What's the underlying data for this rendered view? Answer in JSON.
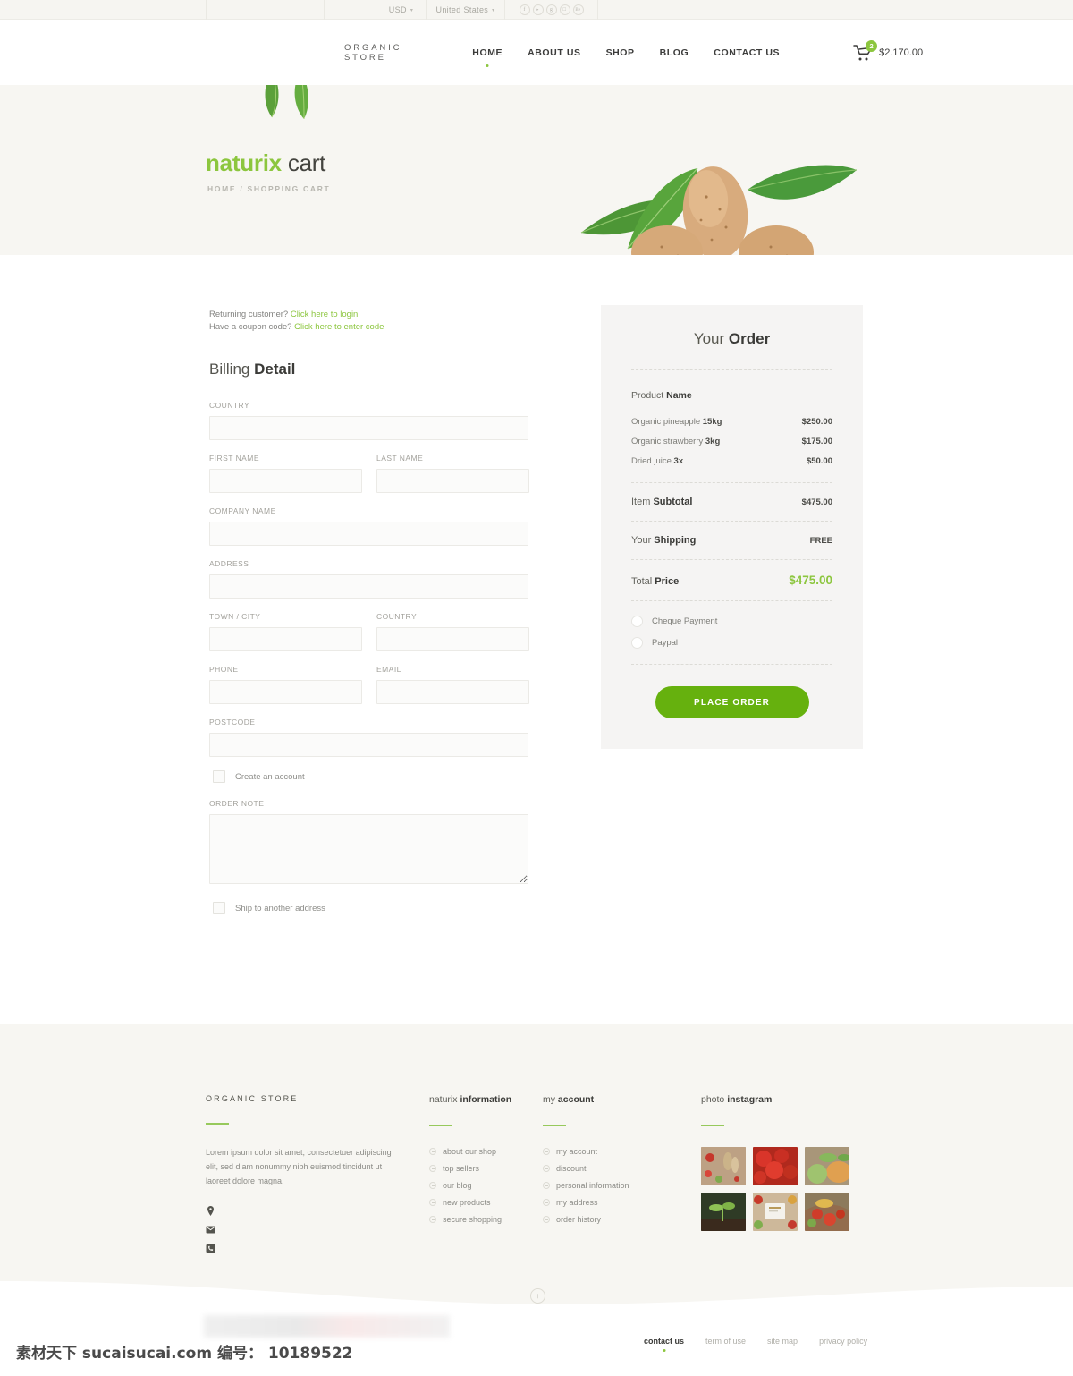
{
  "topbar": {
    "currency": {
      "label": "USD",
      "caret": "chevron-down-icon"
    },
    "country": {
      "label": "United States",
      "caret": "chevron-down-icon"
    },
    "social": [
      {
        "name": "facebook-icon",
        "glyph": "f"
      },
      {
        "name": "twitter-icon",
        "glyph": "ᵛ"
      },
      {
        "name": "google-plus-icon",
        "glyph": "g"
      },
      {
        "name": "instagram-icon",
        "glyph": "▣"
      },
      {
        "name": "behance-icon",
        "glyph": "Be"
      }
    ]
  },
  "header": {
    "brand": "ORGANIC STORE",
    "nav": [
      {
        "label": "HOME",
        "active": true
      },
      {
        "label": "ABOUT US",
        "active": false
      },
      {
        "label": "SHOP",
        "active": false
      },
      {
        "label": "BLOG",
        "active": false
      },
      {
        "label": "CONTACT US",
        "active": false
      }
    ],
    "cart": {
      "icon": "shopping-cart-icon",
      "count": "2",
      "total": "$2.170.00"
    },
    "menu_toggle": "hamburger-menu-icon"
  },
  "hero": {
    "title_accent": "naturix",
    "title_rest": " cart",
    "breadcrumb": "HOME / SHOPPING CART",
    "image_alt": "almonds-with-leaves-photo",
    "leaf_alt": "hanging-leaves-photo"
  },
  "checkout": {
    "returning_prefix": "Returning customer? ",
    "returning_link": "Click here to login",
    "coupon_prefix": "Have a coupon code? ",
    "coupon_link": "Click here to enter code",
    "section_title_light": "Billing ",
    "section_title_bold": "Detail",
    "fields": {
      "country1": "COUNTRY",
      "first_name": "FIRST NAME",
      "last_name": "LAST NAME",
      "company_name": "COMPANY NAME",
      "address": "ADDRESS",
      "town_city": "TOWN / CITY",
      "country2": "COUNTRY",
      "phone": "PHONE",
      "email": "EMAIL",
      "postcode": "POSTCODE",
      "order_note": "ORDER NOTE"
    },
    "values": {
      "country1": "",
      "first_name": "",
      "last_name": "",
      "company_name": "",
      "address": "",
      "town_city": "",
      "country2": "",
      "phone": "",
      "email": "",
      "postcode": "",
      "order_note": ""
    },
    "create_account_label": "Create an account",
    "ship_other_label": "Ship to another address"
  },
  "order": {
    "title_light": "Your ",
    "title_bold": "Order",
    "product_head_light": "Product ",
    "product_head_bold": "Name",
    "items": [
      {
        "name": "Organic pineapple ",
        "qty": "15kg",
        "price": "$250.00"
      },
      {
        "name": "Organic strawberry ",
        "qty": "3kg",
        "price": "$175.00"
      },
      {
        "name": "Dried juice ",
        "qty": "3x",
        "price": "$50.00"
      }
    ],
    "subtotal": {
      "label_light": "Item ",
      "label_bold": "Subtotal",
      "value": "$475.00"
    },
    "shipping": {
      "label_light": "Your ",
      "label_bold": "Shipping",
      "value": "FREE"
    },
    "total": {
      "label_light": "Total ",
      "label_bold": "Price",
      "value": "$475.00"
    },
    "payments": [
      {
        "label": "Cheque Payment",
        "selected": false
      },
      {
        "label": "Paypal",
        "selected": false
      }
    ],
    "place_order_label": "PLACE ORDER",
    "accent_color": "#8cc63e",
    "button_color": "#66b10e",
    "panel_color": "#f5f4f3"
  },
  "footer": {
    "about": {
      "title": "ORGANIC STORE",
      "text": "Lorem ipsum dolor sit amet, consectetuer adipiscing elit, sed diam nonummy nibh euismod tincidunt ut laoreet dolore magna.",
      "contacts": [
        {
          "icon": "location-pin-icon"
        },
        {
          "icon": "envelope-icon"
        },
        {
          "icon": "phone-icon"
        }
      ]
    },
    "info": {
      "title_light": "naturix ",
      "title_bold": "information",
      "links": [
        "about our shop",
        "top sellers",
        "our blog",
        "new products",
        "secure shopping"
      ]
    },
    "account": {
      "title_light": "my ",
      "title_bold": "account",
      "links": [
        "my account",
        "discount",
        "personal information",
        "my address",
        "order history"
      ]
    },
    "instagram": {
      "title_light": "photo ",
      "title_bold": "instagram",
      "photos": [
        "vegetables-on-wood-photo",
        "ripe-tomatoes-photo",
        "pumpkin-and-cabbage-photo",
        "seedling-in-soil-photo",
        "vegetables-frame-with-card-photo",
        "basket-of-vegetables-photo"
      ]
    }
  },
  "bottom": {
    "scroll_top_icon": "arrow-up-circle-icon",
    "links": [
      {
        "label": "contact us",
        "active": true
      },
      {
        "label": "term of use",
        "active": false
      },
      {
        "label": "site map",
        "active": false
      },
      {
        "label": "privacy policy",
        "active": false
      }
    ]
  },
  "watermark": {
    "text": "素材天下 sucaisucai.com  编号： 10189522"
  }
}
